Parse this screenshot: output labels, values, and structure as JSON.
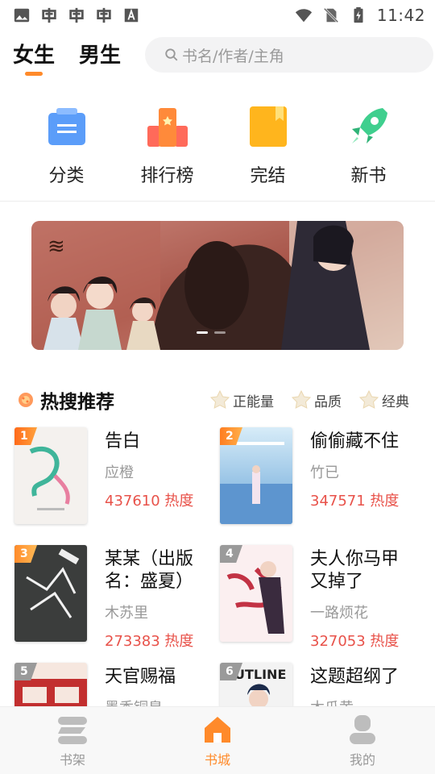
{
  "status": {
    "time": "11:42",
    "icons": [
      "image-icon",
      "bug-icon",
      "bug-icon",
      "bug-icon",
      "a-box-icon",
      "wifi-icon",
      "no-sim-icon",
      "battery-charging-icon"
    ]
  },
  "header": {
    "tabs": [
      {
        "label": "女生",
        "active": true
      },
      {
        "label": "男生",
        "active": false
      }
    ],
    "search_placeholder": "书名/作者/主角"
  },
  "categories": [
    {
      "label": "分类",
      "icon": "category-icon"
    },
    {
      "label": "排行榜",
      "icon": "ranking-icon"
    },
    {
      "label": "完结",
      "icon": "finished-icon"
    },
    {
      "label": "新书",
      "icon": "rocket-icon"
    }
  ],
  "banner": {
    "dots": 2,
    "active": 0
  },
  "hot": {
    "title": "热搜推荐",
    "filters": [
      "正能量",
      "品质",
      "经典"
    ],
    "books": [
      {
        "rank": "1",
        "title": "告白",
        "author": "应橙",
        "heat": "437610 热度"
      },
      {
        "rank": "2",
        "title": "偷偷藏不住",
        "author": "竹已",
        "heat": "347571 热度"
      },
      {
        "rank": "3",
        "title": "某某（出版名：盛夏）",
        "author": "木苏里",
        "heat": "273383 热度"
      },
      {
        "rank": "4",
        "title": "夫人你马甲又掉了",
        "author": "一路烦花",
        "heat": "327053 热度"
      },
      {
        "rank": "5",
        "title": "天官赐福",
        "author": "墨香铜臭",
        "heat": ""
      },
      {
        "rank": "6",
        "title": "这题超纲了",
        "author": "木瓜黄",
        "heat": ""
      }
    ]
  },
  "tabbar": [
    {
      "label": "书架",
      "icon": "bookshelf-icon",
      "active": false
    },
    {
      "label": "书城",
      "icon": "home-icon",
      "active": true
    },
    {
      "label": "我的",
      "icon": "profile-icon",
      "active": false
    }
  ],
  "colors": {
    "accent": "#ff8a2a",
    "heat": "#e8524a"
  }
}
